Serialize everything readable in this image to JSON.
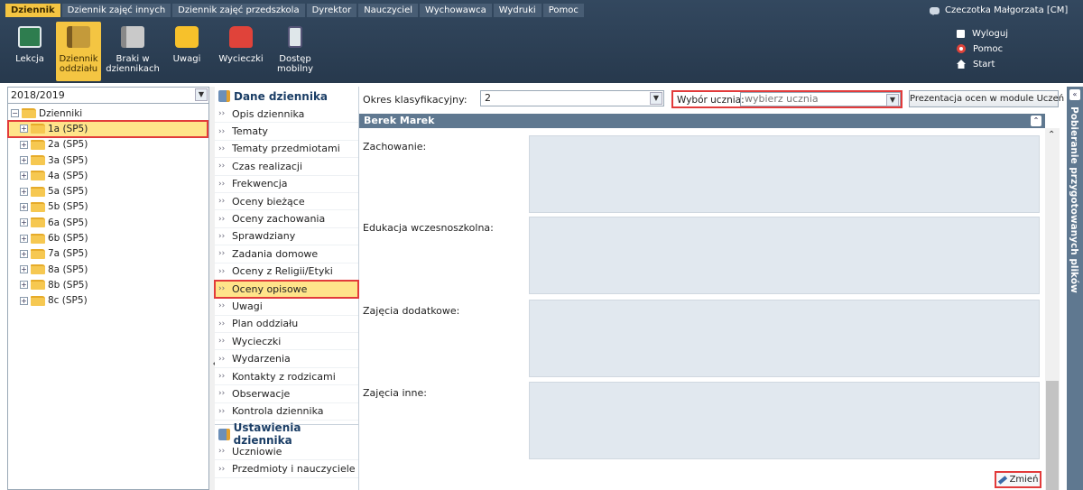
{
  "menu_tabs": [
    "Dziennik",
    "Dziennik zajęć innych",
    "Dziennik zajęć przedszkola",
    "Dyrektor",
    "Nauczyciel",
    "Wychowawca",
    "Wydruki",
    "Pomoc"
  ],
  "user": "Czeczotka Małgorzata [CM]",
  "ribbon": {
    "lekcja": "Lekcja",
    "dziennik": "Dziennik oddziału",
    "braki": "Braki w dziennikach",
    "uwagi": "Uwagi",
    "wycieczki": "Wycieczki",
    "mobilny": "Dostęp mobilny"
  },
  "right_links": {
    "logout": "Wyloguj",
    "help": "Pomoc",
    "start": "Start"
  },
  "year": "2018/2019",
  "tree": {
    "root": "Dzienniki",
    "classes": [
      "1a (SP5)",
      "2a (SP5)",
      "3a (SP5)",
      "4a (SP5)",
      "5a (SP5)",
      "5b (SP5)",
      "6a (SP5)",
      "6b (SP5)",
      "7a (SP5)",
      "8a (SP5)",
      "8b (SP5)",
      "8c (SP5)"
    ]
  },
  "menu": {
    "section1": "Dane dziennika",
    "items": [
      "Opis dziennika",
      "Tematy",
      "Tematy przedmiotami",
      "Czas realizacji",
      "Frekwencja",
      "Oceny bieżące",
      "Oceny zachowania",
      "Sprawdziany",
      "Zadania domowe",
      "Oceny z Religii/Etyki",
      "Oceny opisowe",
      "Uwagi",
      "Plan oddziału",
      "Wycieczki",
      "Wydarzenia",
      "Kontakty z rodzicami",
      "Obserwacje",
      "Kontrola dziennika"
    ],
    "section2": "Ustawienia dziennika",
    "items2": [
      "Uczniowie",
      "Przedmioty i nauczyciele"
    ]
  },
  "filters": {
    "okres_label": "Okres klasyfikacyjny:",
    "okres_value": "2",
    "uczen_label": "Wybór ucznia:",
    "uczen_placeholder": "wybierz ucznia",
    "prezentacja_btn": "Prezentacja ocen w module Uczeń"
  },
  "student_name": "Berek Marek",
  "sections": [
    "Zachowanie:",
    "Edukacja wczesnoszkolna:",
    "Zajęcia dodatkowe:",
    "Zajęcia inne:"
  ],
  "change_btn": "Zmień",
  "side_panel_title": "Pobieranie przygotowanych plików"
}
